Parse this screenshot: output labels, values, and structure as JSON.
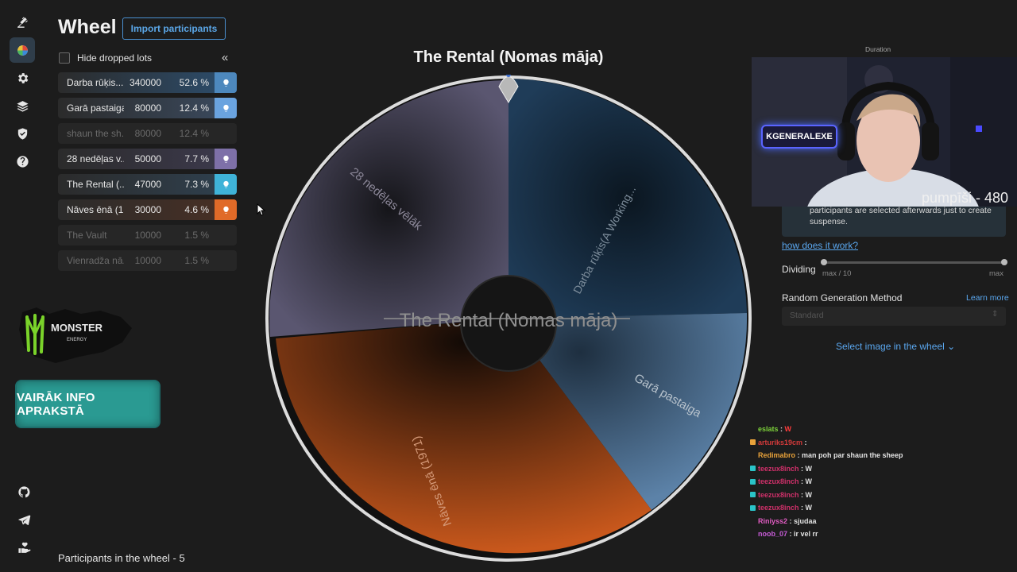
{
  "header": {
    "title": "Wheel",
    "import_label": "Import participants"
  },
  "controls": {
    "hide_dropped_label": "Hide dropped lots",
    "collapse_glyph": "«"
  },
  "lots": [
    {
      "name": "Darba rūķis...",
      "amount": "340000",
      "percent": "52.6 %",
      "color": "#2c4e6e",
      "bulb": "#4d88bd",
      "dropped": false
    },
    {
      "name": "Garā pastaiga",
      "amount": "80000",
      "percent": "12.4 %",
      "color": "#3b4b60",
      "bulb": "#6aa3df",
      "dropped": false
    },
    {
      "name": "shaun the sh...",
      "amount": "80000",
      "percent": "12.4 %",
      "dropped": true
    },
    {
      "name": "28 nedēļas v...",
      "amount": "50000",
      "percent": "7.7 %",
      "color": "#3d3a4e",
      "bulb": "#7e70a8",
      "dropped": false
    },
    {
      "name": "The Rental (...",
      "amount": "47000",
      "percent": "7.3 %",
      "color": "#2f4150",
      "bulb": "#3fb3d8",
      "dropped": false
    },
    {
      "name": "Nāves ēnā (1...",
      "amount": "30000",
      "percent": "4.6 %",
      "color": "#4a3024",
      "bulb": "#e06a28",
      "dropped": false
    },
    {
      "name": "The Vault",
      "amount": "10000",
      "percent": "1.5 %",
      "dropped": true
    },
    {
      "name": "Vienradža nā...",
      "amount": "10000",
      "percent": "1.5 %",
      "dropped": true
    }
  ],
  "footer": {
    "participants_label": "Participants in the wheel - 5"
  },
  "banners": {
    "monster_text": "MONSTER",
    "monster_sub": "ENERGY",
    "info_text": "VAIRĀK INFO APRAKSTĀ"
  },
  "wheel": {
    "title": "The Rental (Nomas māja)",
    "center_text": "The Rental (Nomas māja)",
    "segments": [
      {
        "label": "Darba rūķis(A Working...",
        "color": "#1f3c58"
      },
      {
        "label": "Garā pastaiga",
        "color": "#4b6f93"
      },
      {
        "label": "Nāves ēnā (1971)",
        "color": "#b5501a"
      },
      {
        "label": "28 nedēļas vēlāk",
        "color": "#5a5670"
      }
    ]
  },
  "settings": {
    "duration_label": "Duration",
    "helper_text": "participants are selected afterwards just to create suspense.",
    "how_link": "how does it work?",
    "dividing_label": "Dividing",
    "dividing_min": "max / 10",
    "dividing_max": "max",
    "rgm_label": "Random Generation Method",
    "learn_more": "Learn more",
    "rgm_value": "Standard",
    "select_image": "Select image in the wheel"
  },
  "webcam": {
    "overlay_label": "pumpīši - 480",
    "badge_text": "KGENERALEXE"
  },
  "chat": [
    {
      "user": "eslats",
      "msg": "W",
      "user_color": "#7dd23a",
      "msg_color": "#ff3b3b"
    },
    {
      "user": "arturiks19cm",
      "msg": "",
      "user_color": "#d33a3a",
      "msg_color": "#e2e2e2"
    },
    {
      "user": "Redimabro",
      "msg": "man poh par shaun the sheep",
      "user_color": "#e8a23a",
      "msg_color": "#e2e2e2"
    },
    {
      "user": "teezux8inch",
      "msg": "W",
      "user_color": "#d0306a",
      "msg_color": "#e2e2e2"
    },
    {
      "user": "teezux8inch",
      "msg": "W",
      "user_color": "#d0306a",
      "msg_color": "#e2e2e2"
    },
    {
      "user": "teezux8inch",
      "msg": "W",
      "user_color": "#d0306a",
      "msg_color": "#e2e2e2"
    },
    {
      "user": "teezux8inch",
      "msg": "W",
      "user_color": "#d0306a",
      "msg_color": "#e2e2e2"
    },
    {
      "user": "Riniyss2",
      "msg": "sjudaa",
      "user_color": "#e05cc2",
      "msg_color": "#e2e2e2"
    },
    {
      "user": "noob_07",
      "msg": "ir vel rr",
      "user_color": "#c85cd8",
      "msg_color": "#e2e2e2"
    }
  ]
}
